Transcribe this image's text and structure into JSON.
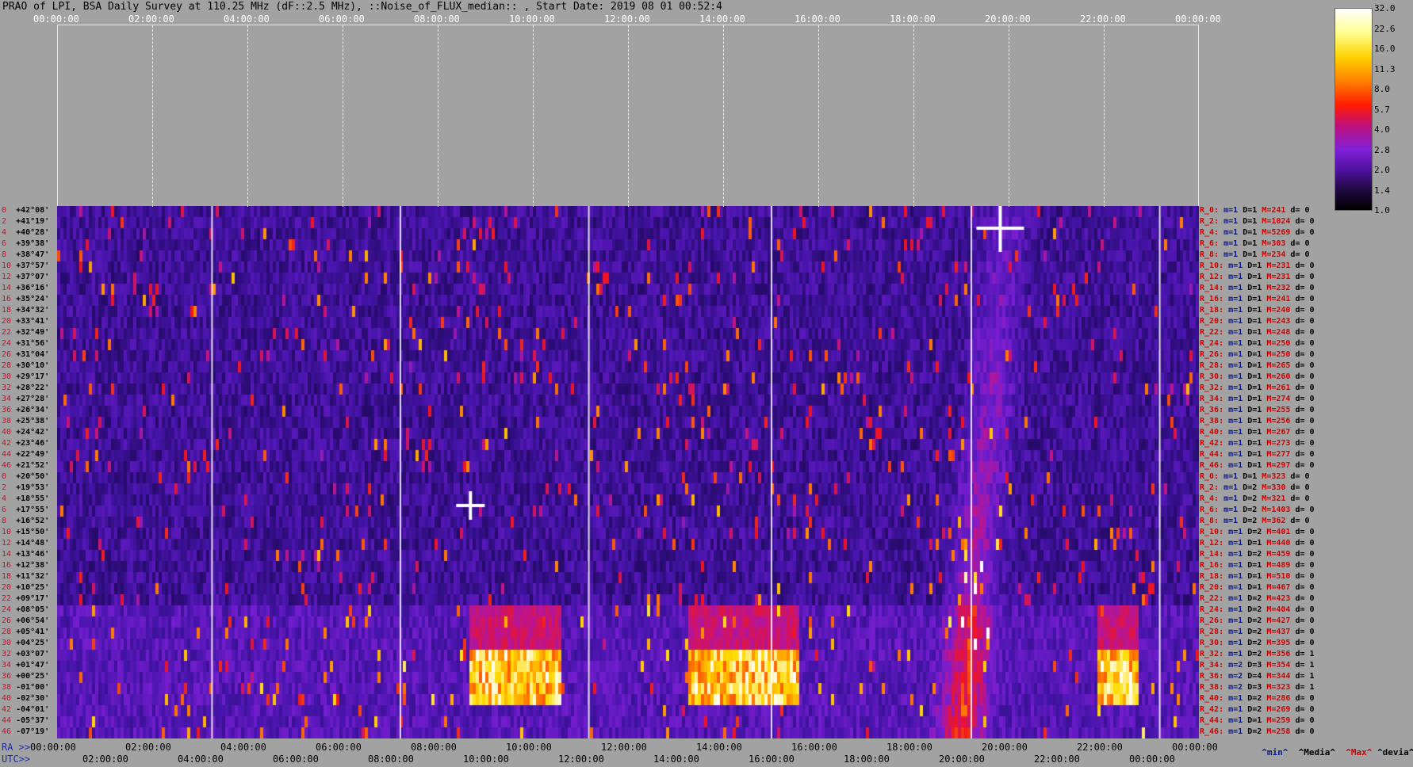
{
  "title": "PRAO of LPI, BSA Daily Survey at 110.25 MHz (dF::2.5 MHz), ::Noise_of_FLUX_median:: , Start Date: 2019 08 01 00:52:4",
  "top_ticks": [
    "00:00:00",
    "02:00:00",
    "04:00:00",
    "06:00:00",
    "08:00:00",
    "10:00:00",
    "12:00:00",
    "14:00:00",
    "16:00:00",
    "18:00:00",
    "20:00:00",
    "22:00:00",
    "00:00:00"
  ],
  "colorbar_ticks": [
    "32.0",
    "22.6",
    "16.0",
    "11.3",
    "8.0",
    "5.7",
    "4.0",
    "2.8",
    "2.0",
    "1.4",
    "1.0"
  ],
  "ra_label": "RA >>",
  "utc_label": "UTC>>",
  "ra_ticks": [
    "00:00:00",
    "02:00:00",
    "04:00:00",
    "06:00:00",
    "08:00:00",
    "10:00:00",
    "12:00:00",
    "14:00:00",
    "16:00:00",
    "18:00:00",
    "20:00:00",
    "22:00:00",
    "00:00:00"
  ],
  "utc_ticks": [
    "02:00:00",
    "04:00:00",
    "06:00:00",
    "08:00:00",
    "10:00:00",
    "12:00:00",
    "14:00:00",
    "16:00:00",
    "18:00:00",
    "20:00:00",
    "22:00:00",
    "00:00:00"
  ],
  "legend_footer": {
    "min": "^min^",
    "media": "^Media^",
    "max": "^Max^",
    "devia": "^devia^"
  },
  "chart_data": {
    "type": "heatmap",
    "title": "PRAO of LPI, BSA Daily Survey at 110.25 MHz (dF::2.5 MHz), ::Noise_of_FLUX_median:: , Start Date: 2019 08 01 00:52:4",
    "x_range_hours": [
      0,
      24
    ],
    "declinations": [
      "+42°08'",
      "+41°19'",
      "+40°28'",
      "+39°38'",
      "+38°47'",
      "+37°57'",
      "+37°07'",
      "+36°16'",
      "+35°24'",
      "+34°32'",
      "+33°41'",
      "+32°49'",
      "+31°56'",
      "+31°04'",
      "+30°10'",
      "+29°17'",
      "+28°22'",
      "+27°28'",
      "+26°34'",
      "+25°38'",
      "+24°42'",
      "+23°46'",
      "+22°49'",
      "+21°52'",
      "+20°50'",
      "+19°53'",
      "+18°55'",
      "+17°55'",
      "+16°52'",
      "+15°50'",
      "+14°48'",
      "+13°46'",
      "+12°38'",
      "+11°32'",
      "+10°25'",
      "+09°17'",
      "+08°05'",
      "+06°54'",
      "+05°41'",
      "+04°25'",
      "+03°07'",
      "+01°47'",
      "+00°25'",
      "-01°00'",
      "-02°30'",
      "-04°01'",
      "-05°37'",
      "-07°19'"
    ],
    "colorbar_range": [
      1.0,
      32.0
    ],
    "row_stats": [
      {
        "r": "R_0:",
        "m": "m=1",
        "D": "D=1",
        "M": "M=241",
        "d": "d= 0"
      },
      {
        "r": "R_2:",
        "m": "m=1",
        "D": "D=1",
        "M": "M=1024",
        "d": "d= 0"
      },
      {
        "r": "R_4:",
        "m": "m=1",
        "D": "D=1",
        "M": "M=5269",
        "d": "d= 0"
      },
      {
        "r": "R_6:",
        "m": "m=1",
        "D": "D=1",
        "M": "M=303",
        "d": "d= 0"
      },
      {
        "r": "R_8:",
        "m": "m=1",
        "D": "D=1",
        "M": "M=234",
        "d": "d= 0"
      },
      {
        "r": "R_10:",
        "m": "m=1",
        "D": "D=1",
        "M": "M=231",
        "d": "d= 0"
      },
      {
        "r": "R_12:",
        "m": "m=1",
        "D": "D=1",
        "M": "M=231",
        "d": "d= 0"
      },
      {
        "r": "R_14:",
        "m": "m=1",
        "D": "D=1",
        "M": "M=232",
        "d": "d= 0"
      },
      {
        "r": "R_16:",
        "m": "m=1",
        "D": "D=1",
        "M": "M=241",
        "d": "d= 0"
      },
      {
        "r": "R_18:",
        "m": "m=1",
        "D": "D=1",
        "M": "M=240",
        "d": "d= 0"
      },
      {
        "r": "R_20:",
        "m": "m=1",
        "D": "D=1",
        "M": "M=243",
        "d": "d= 0"
      },
      {
        "r": "R_22:",
        "m": "m=1",
        "D": "D=1",
        "M": "M=248",
        "d": "d= 0"
      },
      {
        "r": "R_24:",
        "m": "m=1",
        "D": "D=1",
        "M": "M=250",
        "d": "d= 0"
      },
      {
        "r": "R_26:",
        "m": "m=1",
        "D": "D=1",
        "M": "M=250",
        "d": "d= 0"
      },
      {
        "r": "R_28:",
        "m": "m=1",
        "D": "D=1",
        "M": "M=265",
        "d": "d= 0"
      },
      {
        "r": "R_30:",
        "m": "m=1",
        "D": "D=1",
        "M": "M=260",
        "d": "d= 0"
      },
      {
        "r": "R_32:",
        "m": "m=1",
        "D": "D=1",
        "M": "M=261",
        "d": "d= 0"
      },
      {
        "r": "R_34:",
        "m": "m=1",
        "D": "D=1",
        "M": "M=274",
        "d": "d= 0"
      },
      {
        "r": "R_36:",
        "m": "m=1",
        "D": "D=1",
        "M": "M=255",
        "d": "d= 0"
      },
      {
        "r": "R_38:",
        "m": "m=1",
        "D": "D=1",
        "M": "M=256",
        "d": "d= 0"
      },
      {
        "r": "R_40:",
        "m": "m=1",
        "D": "D=1",
        "M": "M=267",
        "d": "d= 0"
      },
      {
        "r": "R_42:",
        "m": "m=1",
        "D": "D=1",
        "M": "M=273",
        "d": "d= 0"
      },
      {
        "r": "R_44:",
        "m": "m=1",
        "D": "D=1",
        "M": "M=277",
        "d": "d= 0"
      },
      {
        "r": "R_46:",
        "m": "m=1",
        "D": "D=1",
        "M": "M=297",
        "d": "d= 0"
      },
      {
        "r": "R_0:",
        "m": "m=1",
        "D": "D=1",
        "M": "M=323",
        "d": "d= 0"
      },
      {
        "r": "R_2:",
        "m": "m=1",
        "D": "D=2",
        "M": "M=330",
        "d": "d= 0"
      },
      {
        "r": "R_4:",
        "m": "m=1",
        "D": "D=2",
        "M": "M=321",
        "d": "d= 0"
      },
      {
        "r": "R_6:",
        "m": "m=1",
        "D": "D=2",
        "M": "M=1403",
        "d": "d= 0"
      },
      {
        "r": "R_8:",
        "m": "m=1",
        "D": "D=2",
        "M": "M=362",
        "d": "d= 0"
      },
      {
        "r": "R_10:",
        "m": "m=1",
        "D": "D=2",
        "M": "M=401",
        "d": "d= 0"
      },
      {
        "r": "R_12:",
        "m": "m=1",
        "D": "D=1",
        "M": "M=440",
        "d": "d= 0"
      },
      {
        "r": "R_14:",
        "m": "m=1",
        "D": "D=2",
        "M": "M=459",
        "d": "d= 0"
      },
      {
        "r": "R_16:",
        "m": "m=1",
        "D": "D=1",
        "M": "M=489",
        "d": "d= 0"
      },
      {
        "r": "R_18:",
        "m": "m=1",
        "D": "D=1",
        "M": "M=510",
        "d": "d= 0"
      },
      {
        "r": "R_20:",
        "m": "m=1",
        "D": "D=1",
        "M": "M=467",
        "d": "d= 0"
      },
      {
        "r": "R_22:",
        "m": "m=1",
        "D": "D=2",
        "M": "M=423",
        "d": "d= 0"
      },
      {
        "r": "R_24:",
        "m": "m=1",
        "D": "D=2",
        "M": "M=404",
        "d": "d= 0"
      },
      {
        "r": "R_26:",
        "m": "m=1",
        "D": "D=2",
        "M": "M=427",
        "d": "d= 0"
      },
      {
        "r": "R_28:",
        "m": "m=1",
        "D": "D=2",
        "M": "M=437",
        "d": "d= 0"
      },
      {
        "r": "R_30:",
        "m": "m=1",
        "D": "D=2",
        "M": "M=395",
        "d": "d= 0"
      },
      {
        "r": "R_32:",
        "m": "m=1",
        "D": "D=2",
        "M": "M=356",
        "d": "d= 1"
      },
      {
        "r": "R_34:",
        "m": "m=2",
        "D": "D=3",
        "M": "M=354",
        "d": "d= 1"
      },
      {
        "r": "R_36:",
        "m": "m=2",
        "D": "D=4",
        "M": "M=344",
        "d": "d= 1"
      },
      {
        "r": "R_38:",
        "m": "m=2",
        "D": "D=3",
        "M": "M=323",
        "d": "d= 1"
      },
      {
        "r": "R_40:",
        "m": "m=1",
        "D": "D=2",
        "M": "M=286",
        "d": "d= 0"
      },
      {
        "r": "R_42:",
        "m": "m=1",
        "D": "D=2",
        "M": "M=269",
        "d": "d= 0"
      },
      {
        "r": "R_44:",
        "m": "m=1",
        "D": "D=1",
        "M": "M=259",
        "d": "d= 0"
      },
      {
        "r": "R_46:",
        "m": "m=1",
        "D": "D=2",
        "M": "M=258",
        "d": "d= 0"
      }
    ],
    "row_numbers": [
      "0",
      "2",
      "4",
      "6",
      "8",
      "10",
      "12",
      "14",
      "16",
      "18",
      "20",
      "22",
      "24",
      "26",
      "28",
      "30",
      "32",
      "34",
      "36",
      "38",
      "40",
      "42",
      "44",
      "46",
      "0",
      "2",
      "4",
      "6",
      "8",
      "10",
      "12",
      "14",
      "16",
      "18",
      "20",
      "22",
      "24",
      "26",
      "28",
      "30",
      "32",
      "34",
      "36",
      "38",
      "40",
      "42",
      "44",
      "46"
    ]
  }
}
